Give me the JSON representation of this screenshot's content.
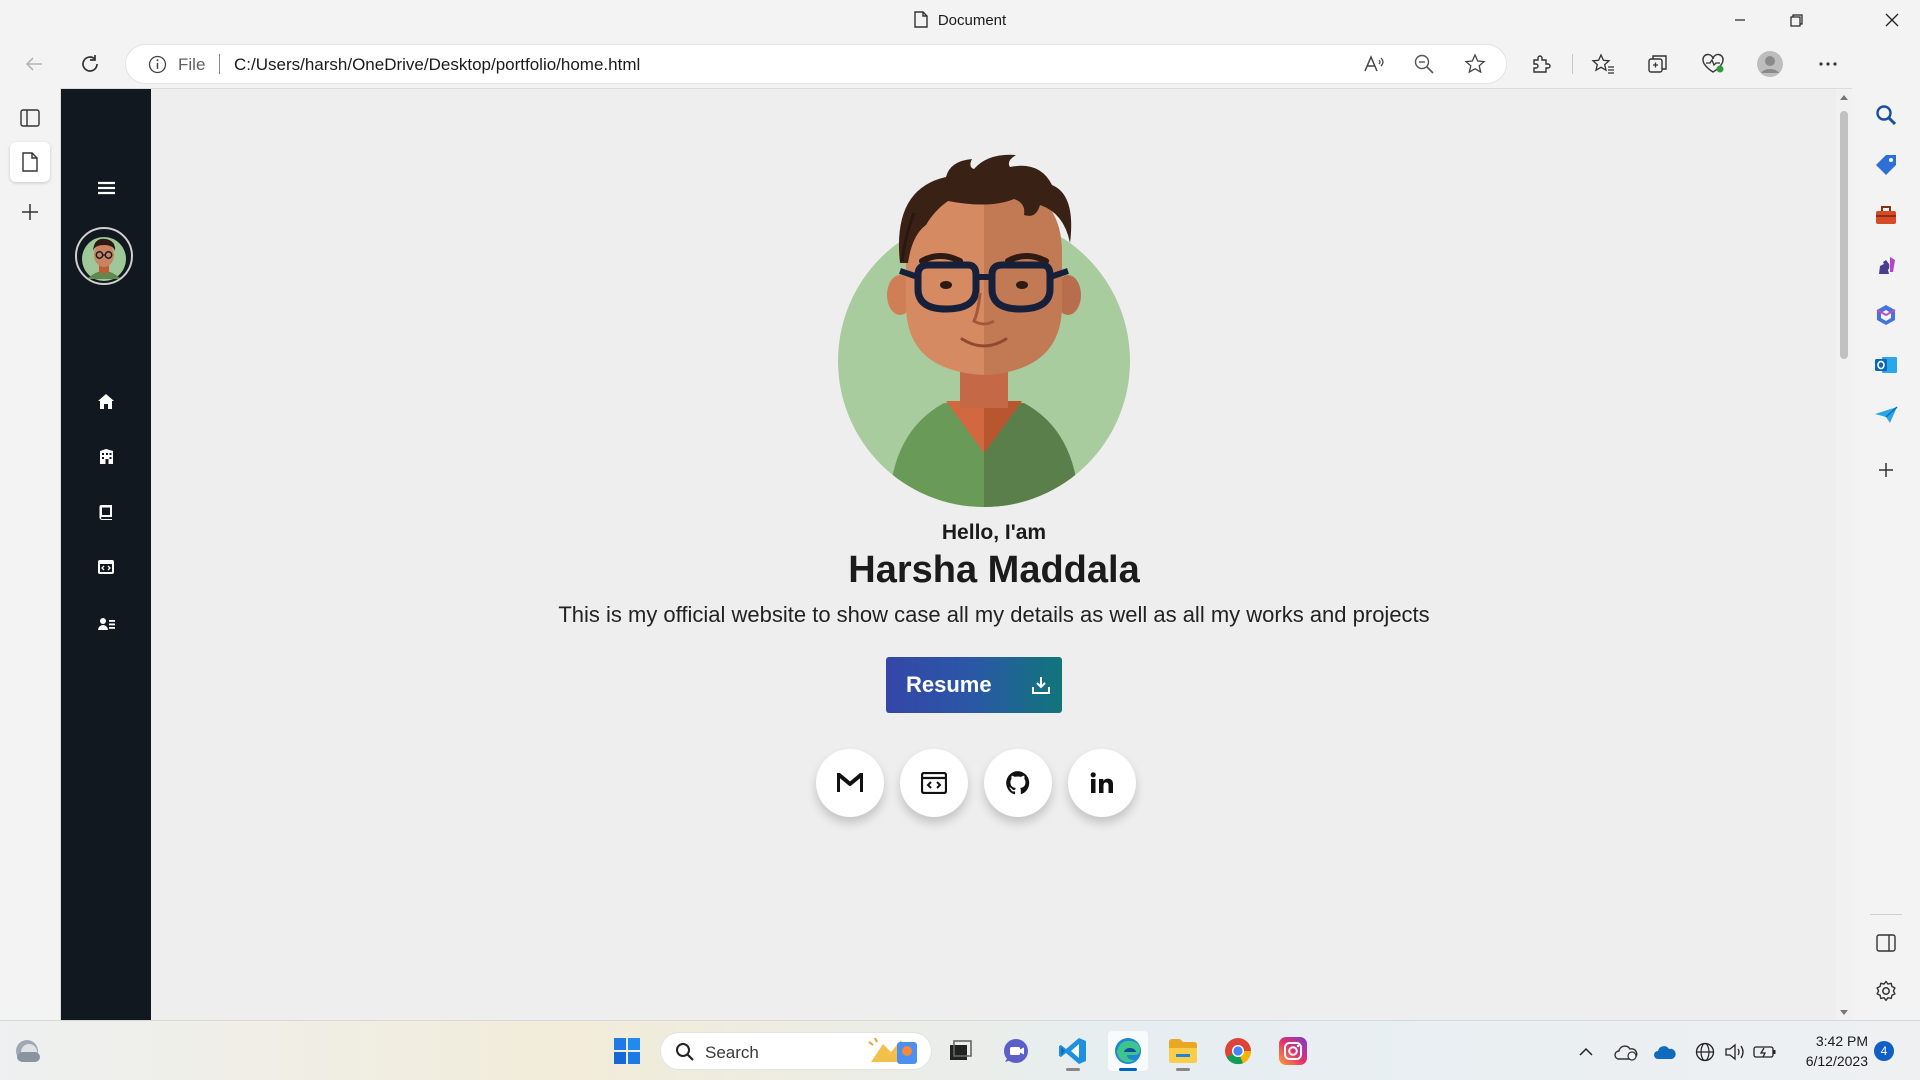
{
  "window": {
    "title": "Document"
  },
  "address_bar": {
    "scheme_label": "File",
    "url": "C:/Users/harsh/OneDrive/Desktop/portfolio/home.html"
  },
  "page": {
    "greeting": "Hello, I'am",
    "name": "Harsha Maddala",
    "description": "This is my official website to show case all my details as well as all my works and projects",
    "resume_button": "Resume",
    "nav_icons": [
      "home-icon",
      "building-icon",
      "book-icon",
      "code-icon",
      "contact-card-icon"
    ],
    "social_icons": [
      "gmail-icon",
      "code-window-icon",
      "github-icon",
      "linkedin-icon"
    ]
  },
  "taskbar": {
    "search_label": "Search",
    "time": "3:42 PM",
    "date": "6/12/2023",
    "notification_count": "4"
  },
  "colors": {
    "site_nav_bg": "#111820",
    "page_bg": "#eeeeee",
    "resume_gradient_start": "#3546a8",
    "resume_gradient_end": "#11757a",
    "windows_accent": "#0067c0"
  }
}
